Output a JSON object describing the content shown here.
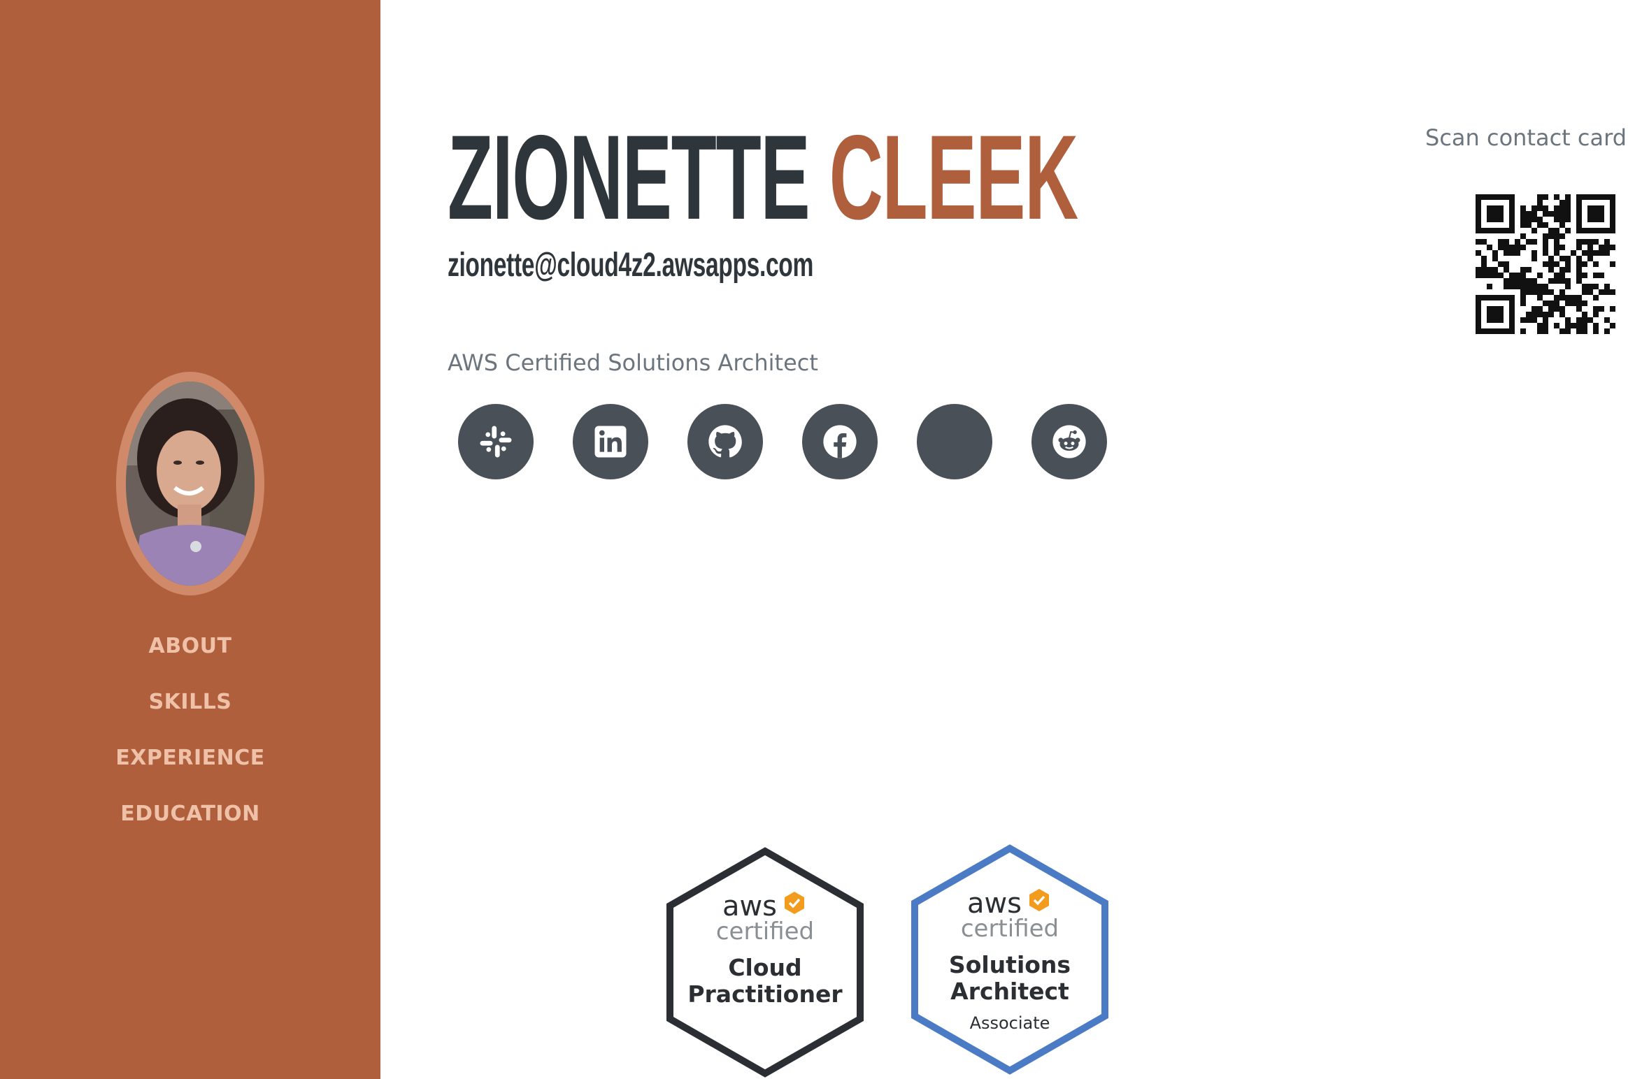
{
  "profile": {
    "first_name": "ZIONETTE",
    "last_name": "CLEEK",
    "email": "zionette@cloud4z2.awsapps.com",
    "title": "AWS Certified Solutions Architect",
    "photo_alt": "profile photo"
  },
  "nav": {
    "items": [
      {
        "label": "ABOUT"
      },
      {
        "label": "SKILLS"
      },
      {
        "label": "EXPERIENCE"
      },
      {
        "label": "EDUCATION"
      }
    ]
  },
  "socials": [
    {
      "icon": "slack-icon"
    },
    {
      "icon": "linkedin-icon"
    },
    {
      "icon": "github-icon"
    },
    {
      "icon": "facebook-icon"
    },
    {
      "icon": "blank-icon"
    },
    {
      "icon": "reddit-icon"
    }
  ],
  "qr": {
    "label": "Scan contact card"
  },
  "badges": [
    {
      "brand": "aws",
      "certified": "certified",
      "line1": "Cloud",
      "line2": "Practitioner",
      "level": "",
      "border_color": "#2b2f33"
    },
    {
      "brand": "aws",
      "certified": "certified",
      "line1": "Solutions",
      "line2": "Architect",
      "level": "Associate",
      "border_color": "#4a7bc4"
    }
  ],
  "colors": {
    "accent": "#b05f3c",
    "dark": "#2f363b",
    "muted": "#6c757d",
    "nav_text": "#efc1a8",
    "social_bg": "#495057",
    "aws_orange": "#f29b1d"
  }
}
